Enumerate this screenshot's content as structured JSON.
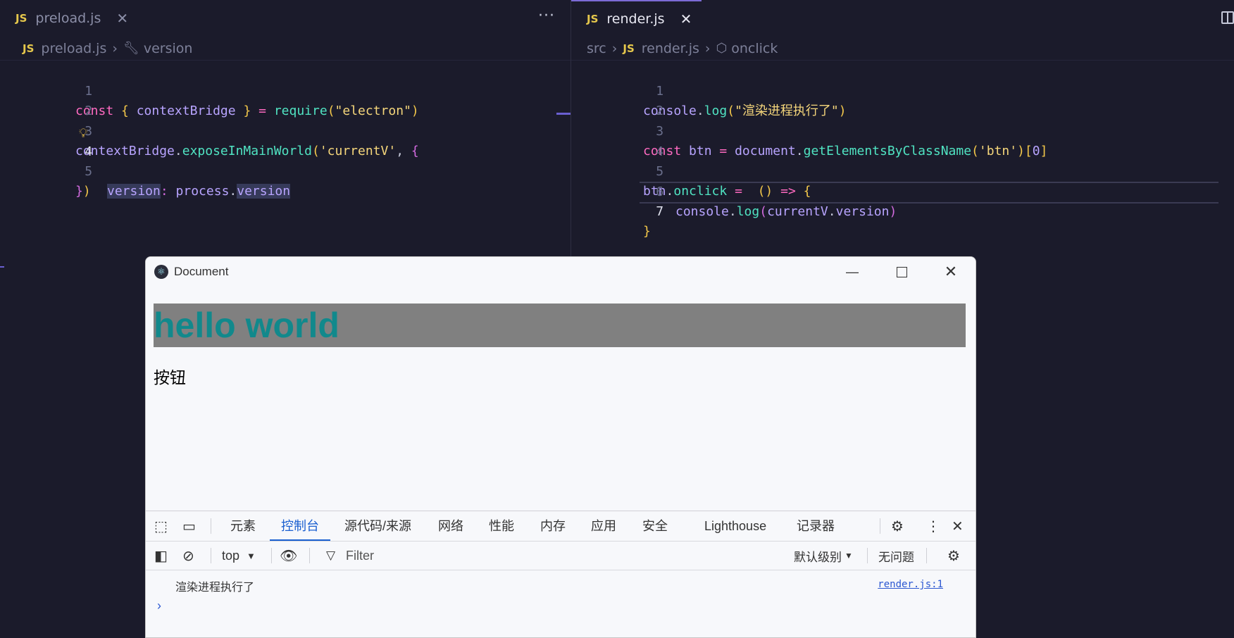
{
  "editor": {
    "left": {
      "tab": {
        "lang": "JS",
        "name": "preload.js",
        "close": "✕"
      },
      "more": "···",
      "breadcrumb": {
        "lang": "JS",
        "file": "preload.js",
        "symbol": "version"
      },
      "line_numbers": [
        "1",
        "2",
        "3",
        "4",
        "5"
      ]
    },
    "right": {
      "tab": {
        "lang": "JS",
        "name": "render.js",
        "close": "✕"
      },
      "breadcrumb": {
        "folder": "src",
        "lang": "JS",
        "file": "render.js",
        "symbol": "onclick"
      },
      "line_numbers": [
        "1",
        "2",
        "3",
        "4",
        "5",
        "6",
        "7"
      ]
    }
  },
  "app_window": {
    "title": "Document",
    "heading": "hello world",
    "button_text": "按钮"
  },
  "devtools": {
    "tabs": [
      "元素",
      "控制台",
      "源代码/来源",
      "网络",
      "性能",
      "内存",
      "应用",
      "安全",
      "Lighthouse",
      "记录器"
    ],
    "active_tab": "控制台",
    "context": "top",
    "filter_placeholder": "Filter",
    "level": "默认级别",
    "issues": "无问题",
    "log": {
      "message": "渲染进程执行了",
      "source": "render.js:1"
    },
    "prompt": "›"
  },
  "colors": {
    "accent": "#7c6bd6",
    "heading": "#11898c",
    "heading_bg": "#808080",
    "link": "#2b57d1"
  }
}
